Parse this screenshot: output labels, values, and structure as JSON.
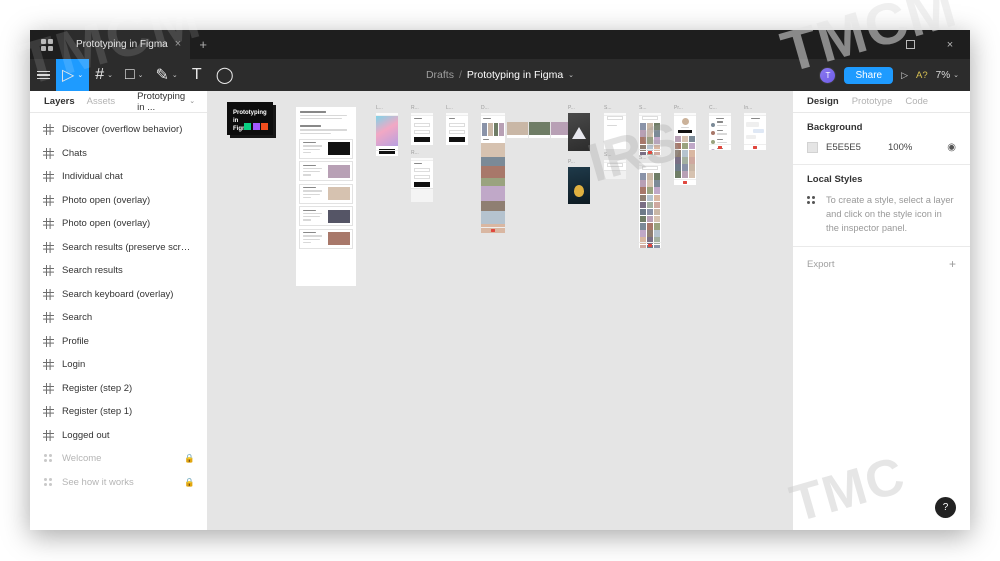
{
  "window": {
    "tab_title": "Prototyping in Figma",
    "tab_close": "×",
    "new_tab": "+",
    "maximize": "",
    "close": "×"
  },
  "toolbar": {
    "menu_icon": "hamburger-icon",
    "tools": [
      {
        "name": "move-tool",
        "glyph": "▷",
        "caret": "⌄",
        "active": true
      },
      {
        "name": "frame-tool",
        "glyph": "#",
        "caret": "⌄",
        "active": false
      },
      {
        "name": "shape-tool",
        "glyph": "□",
        "caret": "⌄",
        "active": false
      },
      {
        "name": "pen-tool",
        "glyph": "✎",
        "caret": "⌄",
        "active": false
      },
      {
        "name": "text-tool",
        "glyph": "T",
        "caret": "",
        "active": false
      },
      {
        "name": "comment-tool",
        "glyph": "◯",
        "caret": "",
        "active": false
      }
    ],
    "breadcrumb": {
      "project": "Drafts",
      "separator": "/",
      "file": "Prototyping in Figma",
      "caret": "⌄"
    },
    "avatar_initial": "T",
    "share_label": "Share",
    "present_icon": "▷",
    "a_badge": "A?",
    "zoom_level": "7%",
    "zoom_caret": "⌄"
  },
  "left_panel": {
    "tabs": [
      {
        "label": "Layers",
        "active": true
      },
      {
        "label": "Assets",
        "active": false
      }
    ],
    "page_name": "Prototyping in ...",
    "page_caret": "⌄",
    "layers": [
      {
        "name": "Discover (overflow behavior)",
        "type": "frame",
        "locked": false
      },
      {
        "name": "Chats",
        "type": "frame",
        "locked": false
      },
      {
        "name": "Individual chat",
        "type": "frame",
        "locked": false
      },
      {
        "name": "Photo open (overlay)",
        "type": "frame",
        "locked": false
      },
      {
        "name": "Photo open (overlay)",
        "type": "frame",
        "locked": false
      },
      {
        "name": "Search results (preserve scroll po...",
        "type": "frame",
        "locked": false
      },
      {
        "name": "Search results",
        "type": "frame",
        "locked": false
      },
      {
        "name": "Search keyboard (overlay)",
        "type": "frame",
        "locked": false
      },
      {
        "name": "Search",
        "type": "frame",
        "locked": false
      },
      {
        "name": "Profile",
        "type": "frame",
        "locked": false
      },
      {
        "name": "Login",
        "type": "frame",
        "locked": false
      },
      {
        "name": "Register (step 2)",
        "type": "frame",
        "locked": false
      },
      {
        "name": "Register (step 1)",
        "type": "frame",
        "locked": false
      },
      {
        "name": "Logged out",
        "type": "frame",
        "locked": false
      },
      {
        "name": "Welcome",
        "type": "component",
        "locked": true
      },
      {
        "name": "See how it works",
        "type": "component",
        "locked": true
      }
    ],
    "lock_glyph": "🔒"
  },
  "right_panel": {
    "tabs": [
      {
        "label": "Design",
        "active": true
      },
      {
        "label": "Prototype",
        "active": false
      },
      {
        "label": "Code",
        "active": false
      }
    ],
    "background": {
      "title": "Background",
      "hex": "E5E5E5",
      "opacity": "100%",
      "visibility_icon": "◉"
    },
    "local_styles": {
      "title": "Local Styles",
      "hint": "To create a style, select a layer and click on the style icon in the inspector panel."
    },
    "export": {
      "label": "Export",
      "add": "+"
    }
  },
  "help": {
    "glyph": "?"
  },
  "canvas": {
    "background_color": "#E5E5E5",
    "cover": {
      "title": "Prototyping in Figma",
      "body": "A hands-on file to learn interactive prototyping, overlays, smart animate and scroll behavior."
    },
    "frames": [
      {
        "label": "Logged out",
        "short": "L..."
      },
      {
        "label": "Register (step 1)",
        "short": "R..."
      },
      {
        "label": "Login",
        "short": "L..."
      },
      {
        "label": "Discover (overflow behavior)",
        "short": "D..."
      },
      {
        "label": "Register (step 2)",
        "short": "R..."
      },
      {
        "label": "Photo open (overlay)",
        "short": "P..."
      },
      {
        "label": "Search",
        "short": "S..."
      },
      {
        "label": "Search results",
        "short": "S..."
      },
      {
        "label": "Profile",
        "short": "Pr..."
      },
      {
        "label": "Chats",
        "short": "C..."
      },
      {
        "label": "Individual chat",
        "short": "In..."
      },
      {
        "label": "Photo open (overlay)",
        "short": "P..."
      },
      {
        "label": "Search keyboard (overlay)",
        "short": "S..."
      },
      {
        "label": "Search results (preserve scroll position)",
        "short": "S..."
      }
    ]
  },
  "watermark": {
    "text": "TMCM"
  }
}
